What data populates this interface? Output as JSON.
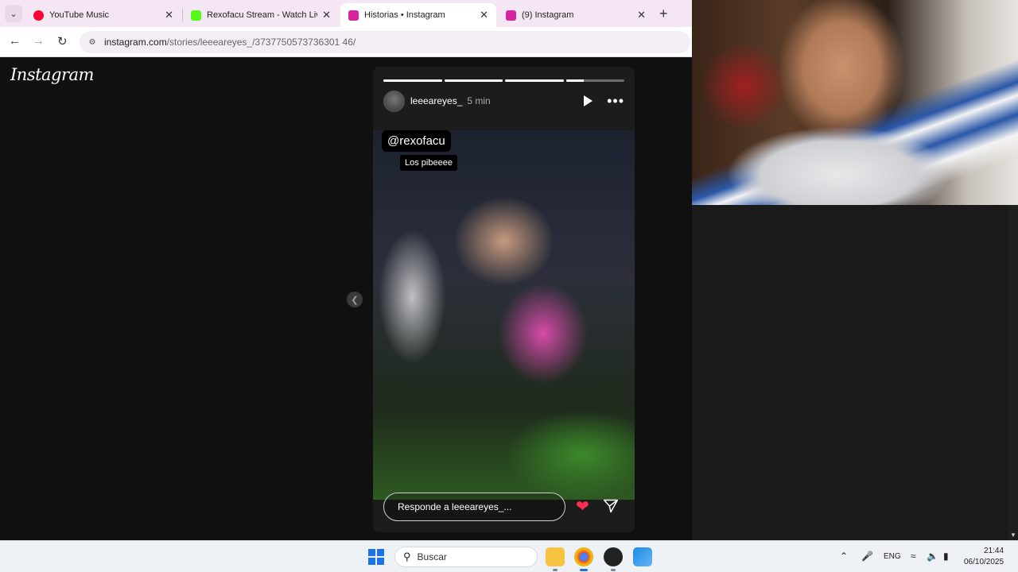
{
  "browser": {
    "tabs": [
      {
        "title": "YouTube Music",
        "favicon_color": "#ff0033",
        "active": false
      },
      {
        "title": "Rexofacu Stream - Watch Live o",
        "favicon_color": "#53fc18",
        "active": false
      },
      {
        "title": "Historias • Instagram",
        "favicon_color": "#d6249f",
        "active": true
      },
      {
        "title": "(9) Instagram",
        "favicon_color": "#d6249f",
        "active": false
      }
    ],
    "url_host": "instagram.com",
    "url_path": "/stories/leeeareyes_/3737750573736301 46/"
  },
  "instagram": {
    "logo": "Instagram",
    "story": {
      "username": "leeeareyes_",
      "time_ago": "5 min",
      "progress": [
        1,
        1,
        1,
        0.3
      ],
      "sticker_mention": "@rexofacu",
      "sticker_text": "Los pibeeee",
      "reply_placeholder": "Responde a leeeareyes_..."
    }
  },
  "taskbar": {
    "search_label": "Buscar",
    "language": "ENG",
    "time": "21:44",
    "date": "06/10/2025"
  }
}
